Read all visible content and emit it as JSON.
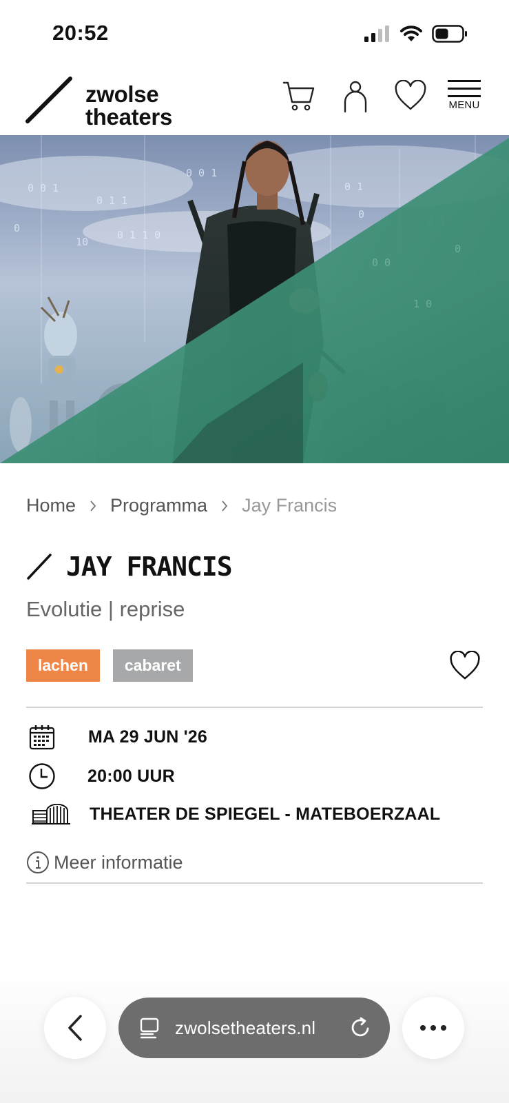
{
  "status_bar": {
    "time": "20:52"
  },
  "header": {
    "logo_line1": "zwolse",
    "logo_line2": "theaters",
    "menu_label": "MENU"
  },
  "breadcrumb": [
    {
      "label": "Home"
    },
    {
      "label": "Programma"
    },
    {
      "label": "Jay Francis"
    }
  ],
  "event": {
    "title": "JAY FRANCIS",
    "subtitle": "Evolutie | reprise",
    "tags": [
      {
        "label": "lachen",
        "color": "#ee8648"
      },
      {
        "label": "cabaret",
        "color": "#a6a8aa"
      }
    ],
    "date": "MA 29 JUN '26",
    "time": "20:00 UUR",
    "venue": "THEATER DE SPIEGEL - MATEBOERZAAL",
    "more_info_label": "Meer informatie"
  },
  "browser": {
    "url": "zwolsetheaters.nl"
  },
  "colors": {
    "accent_green": "#3f9a7e",
    "tag_orange": "#ee8648",
    "tag_grey": "#a6a8aa"
  },
  "icons": [
    "signal-icon",
    "wifi-icon",
    "battery-icon",
    "cart-icon",
    "account-icon",
    "heart-icon",
    "menu-icon",
    "calendar-icon",
    "clock-icon",
    "venue-icon",
    "info-icon",
    "back-icon",
    "reader-icon",
    "reload-icon",
    "more-icon"
  ]
}
